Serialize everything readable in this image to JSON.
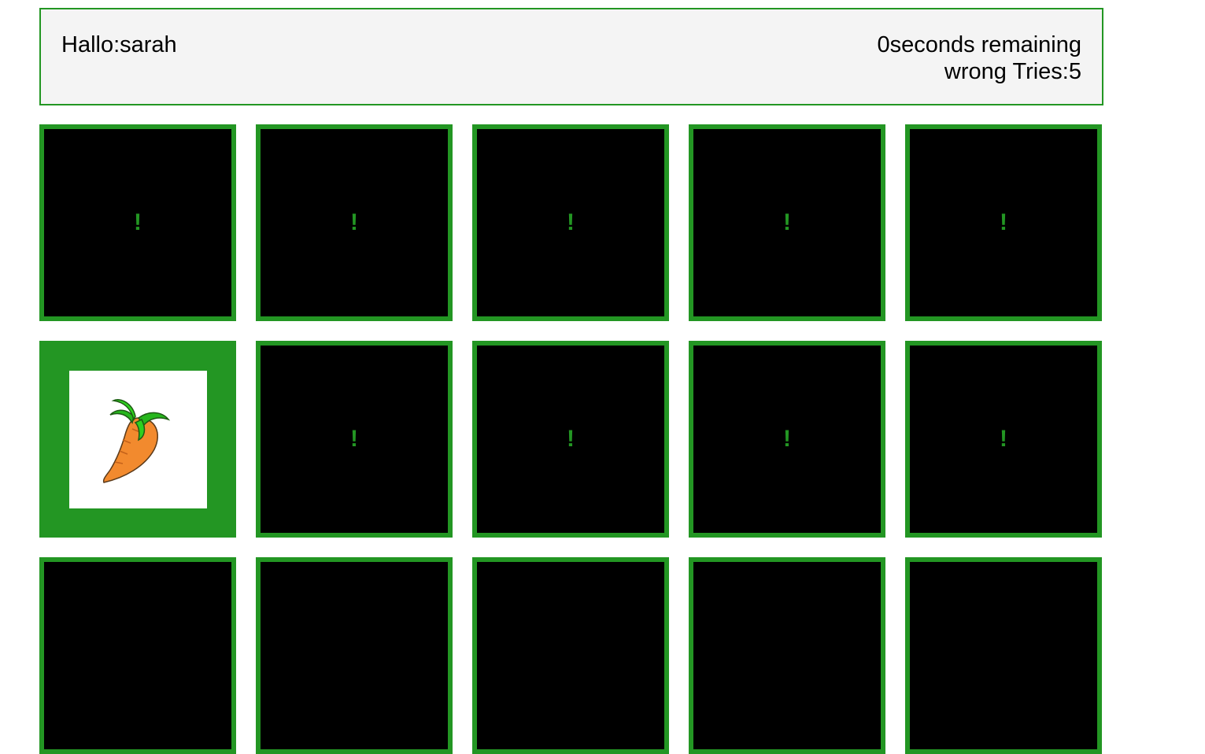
{
  "header": {
    "greeting": "Hallo:sarah",
    "timer": "0seconds remaining",
    "wrong_tries": "wrong Tries:5"
  },
  "colors": {
    "accent": "#239623",
    "card_back": "#000000",
    "header_bg": "#f4f4f4"
  },
  "cards": [
    {
      "state": "hidden",
      "symbol": "!"
    },
    {
      "state": "hidden",
      "symbol": "!"
    },
    {
      "state": "hidden",
      "symbol": "!"
    },
    {
      "state": "hidden",
      "symbol": "!"
    },
    {
      "state": "hidden",
      "symbol": "!"
    },
    {
      "state": "revealed",
      "image": "carrot-icon"
    },
    {
      "state": "hidden",
      "symbol": "!"
    },
    {
      "state": "hidden",
      "symbol": "!"
    },
    {
      "state": "hidden",
      "symbol": "!"
    },
    {
      "state": "hidden",
      "symbol": "!"
    },
    {
      "state": "hidden",
      "symbol": ""
    },
    {
      "state": "hidden",
      "symbol": ""
    },
    {
      "state": "hidden",
      "symbol": ""
    },
    {
      "state": "hidden",
      "symbol": ""
    },
    {
      "state": "hidden",
      "symbol": ""
    }
  ]
}
